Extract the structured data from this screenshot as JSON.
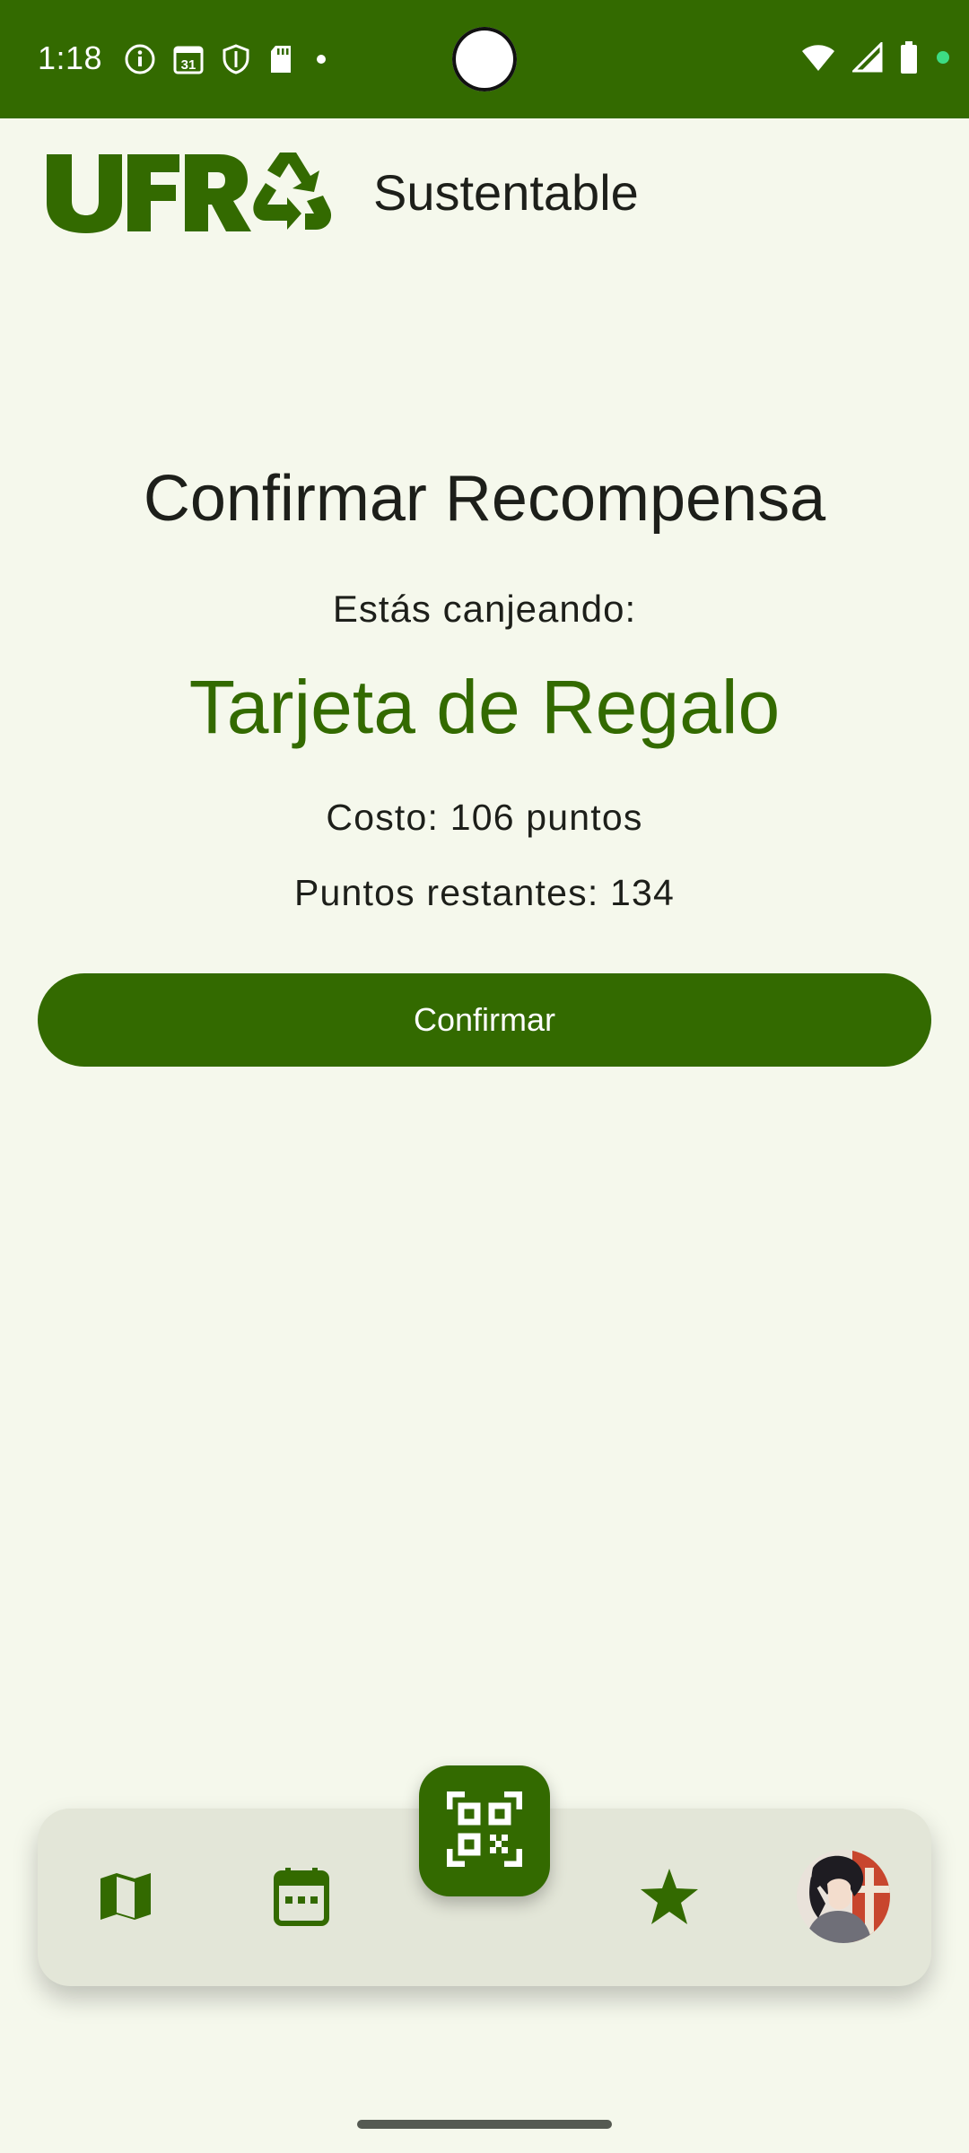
{
  "status_bar": {
    "time": "1:18",
    "left_icons": [
      "info-icon",
      "calendar-31-icon",
      "shield-icon",
      "sd-card-icon",
      "dot-icon"
    ],
    "right_icons": [
      "wifi-icon",
      "signal-icon",
      "battery-icon",
      "privacy-dot-icon"
    ]
  },
  "header": {
    "logo_text": "UFRO",
    "title": "Sustentable"
  },
  "confirmation": {
    "title": "Confirmar Recompensa",
    "redeeming_label": "Estás canjeando:",
    "reward_name": "Tarjeta de Regalo",
    "cost": "Costo: 106 puntos",
    "remaining": "Puntos restantes: 134",
    "confirm_label": "Confirmar"
  },
  "bottom_nav": {
    "items": [
      {
        "icon": "map-icon"
      },
      {
        "icon": "calendar-icon"
      },
      {
        "icon": "qr-code-icon"
      },
      {
        "icon": "star-icon"
      },
      {
        "icon": "avatar"
      }
    ]
  },
  "colors": {
    "primary": "#336a00",
    "background": "#f5f8ec",
    "nav_background": "#e3e6d8",
    "text": "#1d1f1a"
  }
}
